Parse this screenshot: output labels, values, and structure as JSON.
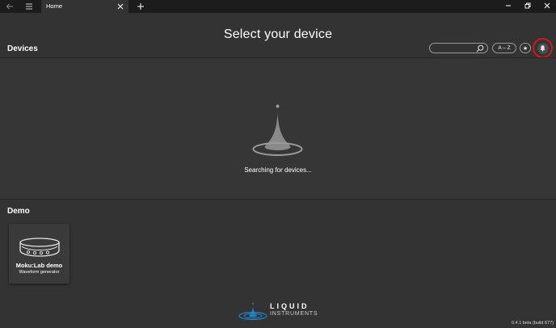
{
  "titlebar": {
    "back_icon": "arrow-left-icon",
    "menu_icon": "hamburger-icon",
    "tab_label": "Home",
    "tab_close_icon": "close-icon",
    "new_tab_icon": "plus-icon",
    "minimize_icon": "minimize-icon",
    "restore_icon": "restore-icon",
    "close_icon": "close-icon"
  },
  "header": {
    "title": "Select your device",
    "search": {
      "value": "",
      "placeholder": "",
      "icon": "search-icon"
    },
    "sort_label": "A – Z",
    "star_label": "★",
    "bell_icon": "bell-icon",
    "highlight_color": "#d01818"
  },
  "devices": {
    "heading": "Devices",
    "status": "Searching for devices...",
    "illustration": "water-drop-icon"
  },
  "demo": {
    "heading": "Demo",
    "cards": [
      {
        "title": "Moku:Lab demo",
        "subtitle": "Waveform generator",
        "icon": "moku-device-icon"
      }
    ]
  },
  "footer": {
    "logo_top": "LIQUID",
    "logo_bottom": "INSTRUMENTS",
    "logo_accent": "#1e88c8",
    "version": "0.4.1 beta (build 677)"
  }
}
